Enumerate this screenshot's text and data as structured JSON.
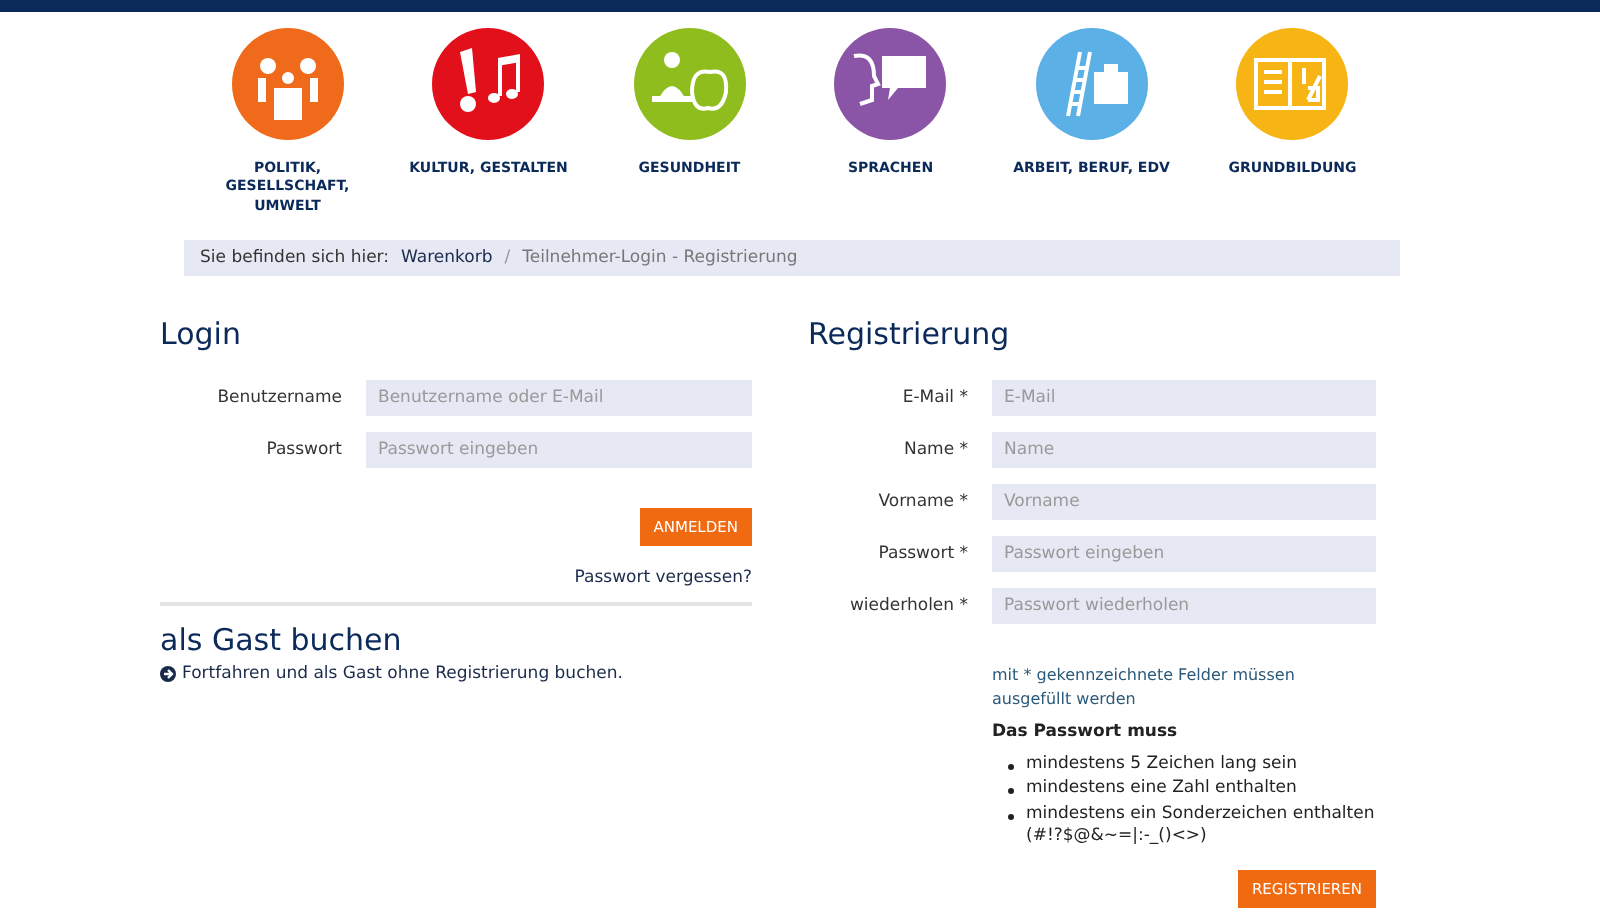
{
  "categories": [
    {
      "label": "POLITIK, GESELLSCHAFT, UMWELT",
      "kind": "people",
      "color": "#ef6a1a"
    },
    {
      "label": "KULTUR, GESTALTEN",
      "kind": "art",
      "color": "#e2101a"
    },
    {
      "label": "GESUNDHEIT",
      "kind": "health",
      "color": "#8fbd1d"
    },
    {
      "label": "SPRACHEN",
      "kind": "speech",
      "color": "#8a55a6"
    },
    {
      "label": "ARBEIT, BERUF, EDV",
      "kind": "work",
      "color": "#5bb0e6"
    },
    {
      "label": "GRUNDBILDUNG",
      "kind": "book",
      "color": "#f7b515"
    }
  ],
  "breadcrumb": {
    "prefix": "Sie befinden sich hier:",
    "separator": "/",
    "items": [
      {
        "label": "Warenkorb",
        "selected": false
      },
      {
        "label": "Teilnehmer-Login - Registrierung",
        "selected": true
      }
    ]
  },
  "login": {
    "title": "Login",
    "fields": [
      {
        "label": "Benutzername",
        "placeholder": "Benutzername oder E-Mail"
      },
      {
        "label": "Passwort",
        "placeholder": "Passwort eingeben"
      }
    ],
    "button": "ANMELDEN",
    "forgot_link": "Passwort vergessen?"
  },
  "guest": {
    "title": "als Gast buchen",
    "link": "Fortfahren und als Gast ohne Registrierung buchen."
  },
  "register": {
    "title": "Registrierung",
    "fields": [
      {
        "label": "E-Mail *",
        "placeholder": "E-Mail"
      },
      {
        "label": "Name *",
        "placeholder": "Name"
      },
      {
        "label": "Vorname *",
        "placeholder": "Vorname"
      },
      {
        "label": "Passwort *",
        "placeholder": "Passwort eingeben"
      },
      {
        "label": "wiederholen *",
        "placeholder": "Passwort wiederholen"
      }
    ],
    "required_note": "mit * gekennzeichnete Felder müssen ausgefüllt werden",
    "rules_title": "Das Passwort muss",
    "rules": [
      "mindestens 5 Zeichen lang sein",
      "mindestens eine Zahl enthalten",
      "mindestens ein Sonderzeichen enthalten (#!?$@&~=|:-_()<>)"
    ],
    "button": "REGISTRIEREN"
  }
}
